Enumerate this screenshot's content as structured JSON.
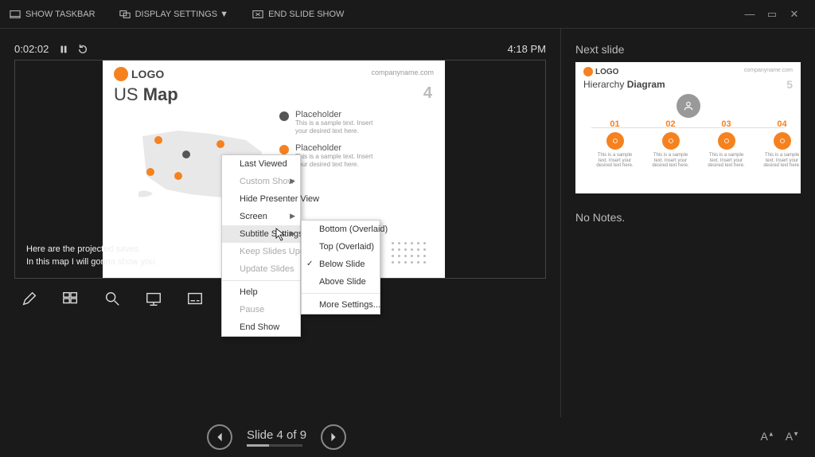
{
  "topbar": {
    "show_taskbar": "SHOW TASKBAR",
    "display_settings": "DISPLAY SETTINGS ▼",
    "end_show": "END SLIDE SHOW"
  },
  "timer": {
    "elapsed": "0:02:02",
    "clock": "4:18 PM"
  },
  "current_slide": {
    "logo_text": "LOGO",
    "url": "companyname.com",
    "title_pre": "US ",
    "title_bold": "Map",
    "number": "4",
    "placeholders": [
      {
        "title": "Placeholder",
        "text": "This is a sample text. Insert your desired text here.",
        "color": "#555"
      },
      {
        "title": "Placeholder",
        "text": "This is a sample text. Insert your desired text here.",
        "color": "#f5821f"
      }
    ],
    "caption_l1": "Here are the projected saves.",
    "caption_l2": "In this map I will gonna show you."
  },
  "context_menu": {
    "items": [
      {
        "label": "Last Viewed",
        "enabled": true
      },
      {
        "label": "Custom Show",
        "enabled": false,
        "submenu": true
      },
      {
        "label": "Hide Presenter View",
        "enabled": true
      },
      {
        "label": "Screen",
        "enabled": true,
        "submenu": true
      },
      {
        "label": "Subtitle Settings",
        "enabled": true,
        "submenu": true,
        "hover": true
      },
      {
        "label": "Keep Slides Updated",
        "enabled": false
      },
      {
        "label": "Update Slides",
        "enabled": false
      },
      {
        "label": "Help",
        "enabled": true
      },
      {
        "label": "Pause",
        "enabled": false
      },
      {
        "label": "End Show",
        "enabled": true
      }
    ],
    "sub": [
      {
        "label": "Bottom (Overlaid)"
      },
      {
        "label": "Top (Overlaid)"
      },
      {
        "label": "Below Slide",
        "checked": true
      },
      {
        "label": "Above Slide"
      },
      {
        "label": "More Settings..."
      }
    ]
  },
  "footer": {
    "counter": "Slide 4 of 9"
  },
  "next": {
    "heading": "Next slide",
    "logo_text": "LOGO",
    "url": "companyname.com",
    "title_pre": "Hierarchy ",
    "title_bold": "Diagram",
    "number": "5",
    "nodes": [
      {
        "num": "01",
        "txt": "This is a sample text. Insert your desired text here."
      },
      {
        "num": "02",
        "txt": "This is a sample text. Insert your desired text here."
      },
      {
        "num": "03",
        "txt": "This is a sample text. Insert your desired text here."
      },
      {
        "num": "04",
        "txt": "This is a sample text. Insert your desired text here."
      }
    ]
  },
  "notes": "No Notes."
}
